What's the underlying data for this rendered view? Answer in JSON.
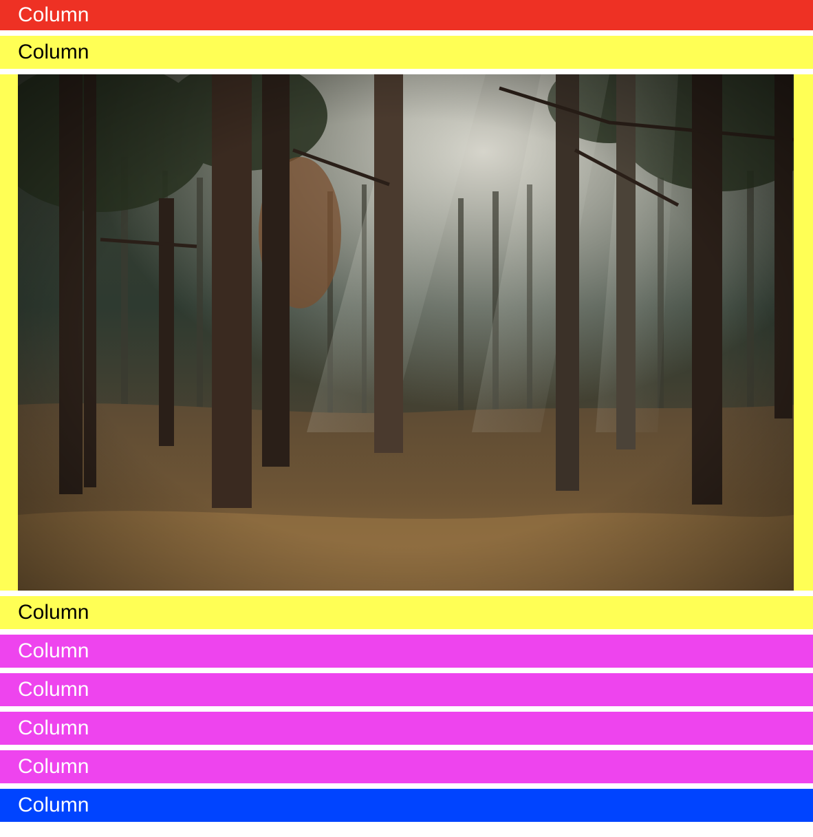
{
  "rows": [
    {
      "label": "Column",
      "bg": "#ee3124"
    },
    {
      "label": "Column",
      "bg": "#ffff55"
    },
    {
      "label": "Column",
      "bg": "#ffff55"
    },
    {
      "label": "Column",
      "bg": "#ee44ee"
    },
    {
      "label": "Column",
      "bg": "#ee44ee"
    },
    {
      "label": "Column",
      "bg": "#ee44ee"
    },
    {
      "label": "Column",
      "bg": "#ee44ee"
    },
    {
      "label": "Column",
      "bg": "#0044ff"
    }
  ],
  "image_block": {
    "bg": "#ffff55",
    "alt": "forest-photo"
  }
}
